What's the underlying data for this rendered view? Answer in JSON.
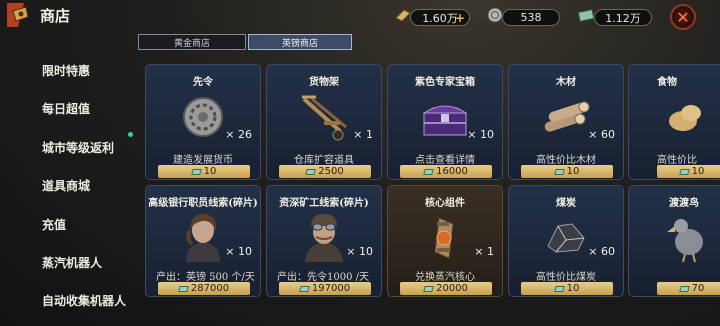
{
  "header": {
    "title": "商店"
  },
  "currency": [
    {
      "icon": "gold-bar-icon",
      "value": "1.60万"
    },
    {
      "icon": "coin-icon",
      "value": "538"
    },
    {
      "icon": "banknote-icon",
      "value": "1.12万"
    }
  ],
  "tabs": [
    {
      "label": "黄金商店"
    },
    {
      "label": "英镑商店"
    }
  ],
  "sidebar": {
    "items": [
      {
        "label": "限时特惠"
      },
      {
        "label": "每日超值"
      },
      {
        "label": "城市等级返利"
      },
      {
        "label": "道具商城"
      },
      {
        "label": "充值"
      },
      {
        "label": "蒸汽机器人"
      },
      {
        "label": "自动收集机器人"
      }
    ]
  },
  "cards": [
    {
      "name": "先令",
      "qty": "× 26",
      "desc": "建造发展货币",
      "price": "10",
      "icon": "shilling-coin-icon"
    },
    {
      "name": "货物架",
      "qty": "× 1",
      "desc": "仓库扩容道具",
      "price": "2500",
      "icon": "hand-truck-icon"
    },
    {
      "name": "紫色专家宝箱",
      "qty": "× 10",
      "desc": "点击查看详情",
      "price": "16000",
      "icon": "purple-chest-icon"
    },
    {
      "name": "木材",
      "qty": "× 60",
      "desc": "高性价比木材",
      "price": "10",
      "icon": "wood-logs-icon"
    },
    {
      "name": "食物",
      "qty": "",
      "desc": "高性价比",
      "price": "10",
      "icon": "food-icon"
    },
    {
      "name": "高级银行职员线索(碎片)",
      "qty": "× 10",
      "desc": "产出：英镑 500 个/天",
      "price": "287000",
      "icon": "bank-clerk-portrait-icon"
    },
    {
      "name": "资深矿工线索(碎片)",
      "qty": "× 10",
      "desc": "产出：先令1000 /天",
      "price": "197000",
      "icon": "miner-portrait-icon"
    },
    {
      "name": "核心组件",
      "qty": "× 1",
      "desc": "兑换蒸汽核心",
      "price": "20000",
      "icon": "steam-core-icon"
    },
    {
      "name": "煤炭",
      "qty": "× 60",
      "desc": "高性价比煤炭",
      "price": "10",
      "icon": "coal-icon"
    },
    {
      "name": "渡渡鸟",
      "qty": "",
      "desc": "",
      "price": "70",
      "icon": "dodo-bird-icon"
    }
  ]
}
